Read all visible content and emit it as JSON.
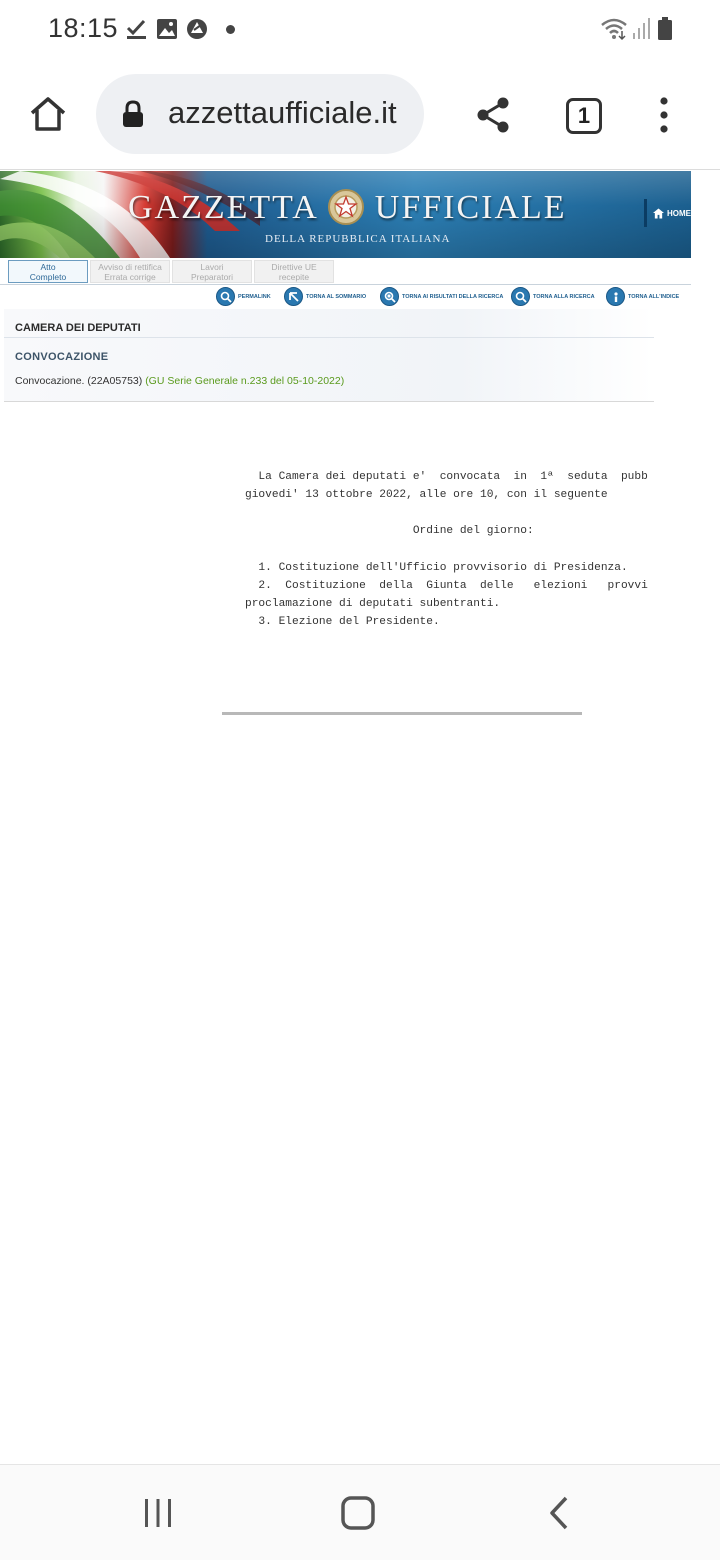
{
  "status_bar": {
    "time": "18:15",
    "icons": [
      "check-icon",
      "image-icon",
      "vpn-icon",
      "wifi-icon",
      "signal-icon",
      "battery-icon"
    ]
  },
  "browser": {
    "url": "azzettaufficiale.it",
    "tab_count": "1",
    "icons": [
      "home-icon",
      "lock-icon",
      "share-icon",
      "tabs-icon",
      "more-vert-icon"
    ]
  },
  "site": {
    "banner_title_left": "GAZZETTA",
    "banner_title_right": "UFFICIALE",
    "banner_subtitle": "DELLA REPUBBLICA ITALIANA",
    "home_label": "HOME",
    "tabs": [
      {
        "line1": "Atto",
        "line2": "Completo"
      },
      {
        "line1": "Avviso di rettifica",
        "line2": "Errata corrige"
      },
      {
        "line1": "Lavori",
        "line2": "Preparatori"
      },
      {
        "line1": "Direttive UE",
        "line2": "recepite"
      }
    ],
    "actions": [
      {
        "label": "PERMALINK"
      },
      {
        "label": "TORNA AL SOMMARIO"
      },
      {
        "label": "TORNA AI RISULTATI DELLA RICERCA"
      },
      {
        "label": "TORNA ALLA RICERCA"
      },
      {
        "label": "TORNA ALL'INDICE"
      }
    ]
  },
  "document": {
    "issuer": "CAMERA DEI DEPUTATI",
    "type": "CONVOCAZIONE",
    "summary": "Convocazione. (22A05753)",
    "gu_ref": "(GU Serie Generale n.233 del 05-10-2022)",
    "lines": [
      "  La Camera dei deputati e'  convocata  in  1ª  seduta  pubb",
      "giovedi' 13 ottobre 2022, alle ore 10, con il seguente",
      "                         Ordine del giorno:",
      "  1. Costituzione dell'Ufficio provvisorio di Presidenza.",
      "  2.  Costituzione  della  Giunta  delle   elezioni   provvi",
      "proclamazione di deputati subentranti.",
      "  3. Elezione del Presidente."
    ]
  },
  "navigation_bar": {
    "icons": [
      "recent-apps-icon",
      "home-button-icon",
      "back-icon"
    ]
  }
}
